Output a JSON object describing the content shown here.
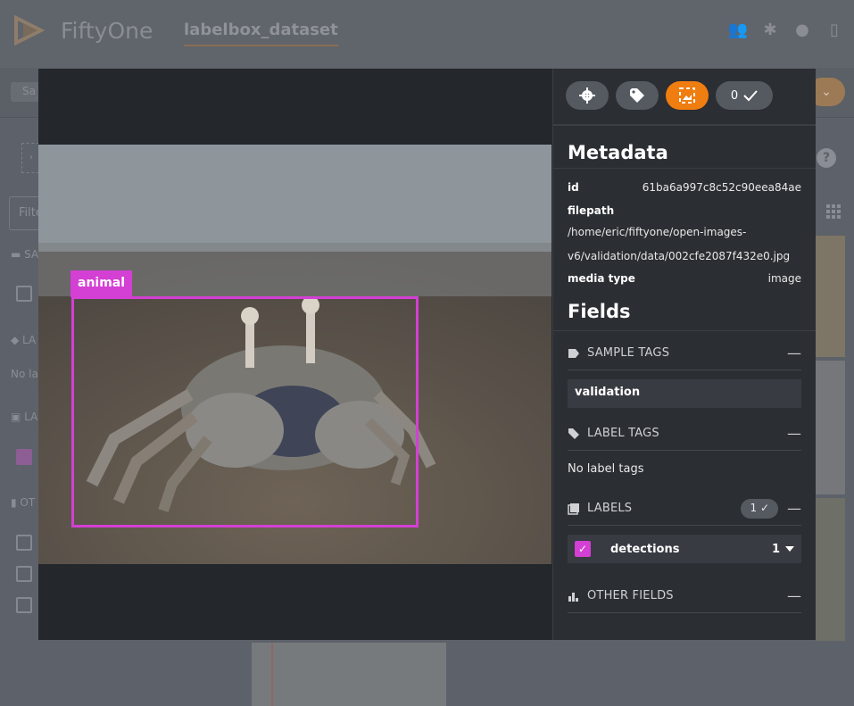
{
  "app": {
    "brand": "FiftyOne",
    "dataset_name": "labelbox_dataset"
  },
  "header_icons": [
    "people-icon",
    "slack-icon",
    "github-icon",
    "book-icon"
  ],
  "background": {
    "view_bar_text": "Sa",
    "filter_placeholder": "Filte",
    "side_labels": [
      "SA",
      "LA",
      "No la",
      "LA",
      "OT"
    ]
  },
  "modal": {
    "toolbar": {
      "settings_icon": "gear-icon",
      "tag_icon": "tag-icon",
      "expand_icon": "crop-icon",
      "selected_count": "0"
    },
    "annotation": {
      "label": "animal",
      "color": "#d43fd4"
    },
    "metadata": {
      "title": "Metadata",
      "id_key": "id",
      "id_value": "61ba6a997c8c52c90eea84ae",
      "filepath_key": "filepath",
      "filepath_line1": "/home/eric/fiftyone/open-images-",
      "filepath_line2": "v6/validation/data/002cfe2087f432e0.jpg",
      "media_type_key": "media type",
      "media_type_value": "image"
    },
    "fields": {
      "title": "Fields",
      "sample_tags_header": "SAMPLE TAGS",
      "sample_tag_value": "validation",
      "label_tags_header": "LABEL TAGS",
      "label_tags_empty": "No label tags",
      "labels_header": "LABELS",
      "labels_count": "1",
      "detections_name": "detections",
      "detections_count": "1",
      "other_fields_header": "OTHER FIELDS",
      "collapse_symbol": "—"
    }
  },
  "colors": {
    "accent_orange": "#f07d10",
    "label_magenta": "#d43fd4",
    "panel_bg": "#2b2e33"
  }
}
